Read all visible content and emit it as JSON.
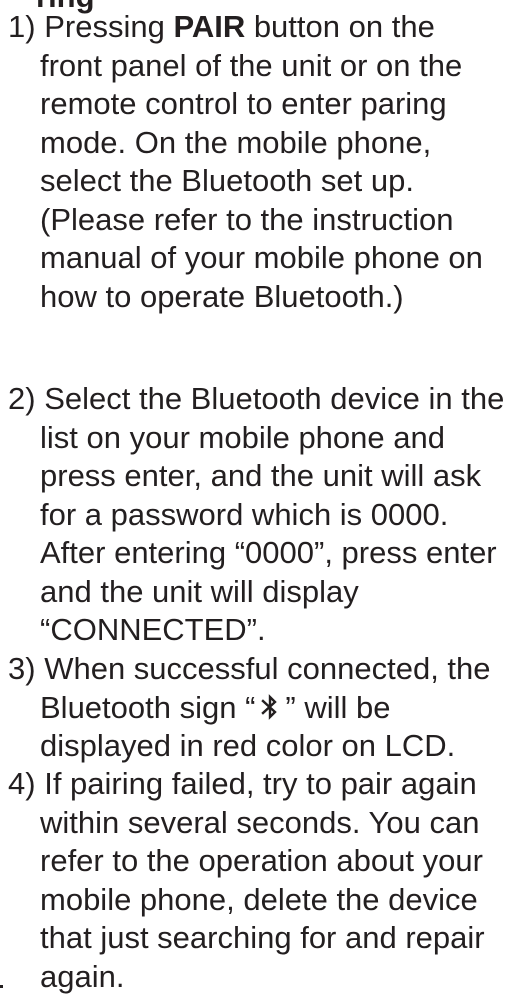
{
  "heading_fragment": "ring",
  "steps": [
    {
      "number": "1)",
      "lead_before": "Pressing ",
      "lead_bold": "PAIR",
      "lead_after": " button on the",
      "lines": [
        "front panel of the unit or on the",
        "remote control to enter paring",
        "mode. On the mobile phone,",
        "select the Bluetooth set up.",
        "(Please refer to the instruction",
        "manual of your mobile phone on",
        "how to operate Bluetooth.)"
      ]
    },
    {
      "number": "2)",
      "lead": "Select the Bluetooth device in the",
      "lines": [
        "list on your mobile phone and",
        "press enter, and the unit will ask",
        "for a password which is 0000.",
        "After entering “0000”, press enter",
        "and the unit will display",
        "“CONNECTED”."
      ]
    },
    {
      "number": "3)",
      "lead": "When successful connected, the",
      "line2_before": "Bluetooth sign “",
      "line2_icon": "bluetooth-icon",
      "line2_after": "” will be",
      "lines": [
        "displayed in red color on LCD."
      ]
    },
    {
      "number": "4)",
      "lead": "If pairing failed, try to pair again",
      "lines": [
        "within several seconds. You can",
        "refer to the operation about your",
        "mobile phone, delete the device",
        "that just searching for and repair",
        "again."
      ]
    }
  ]
}
